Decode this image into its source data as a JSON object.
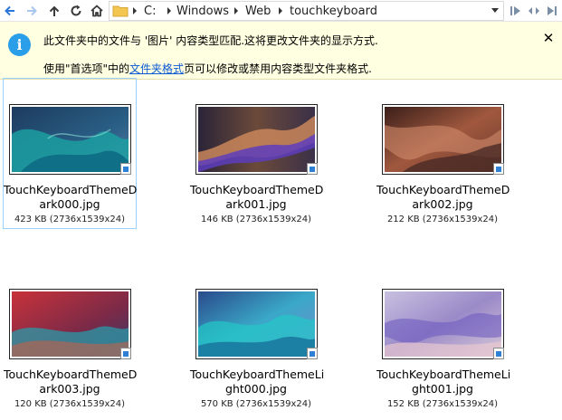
{
  "breadcrumb": {
    "items": [
      "C:",
      "Windows",
      "Web",
      "touchkeyboard"
    ]
  },
  "infobar": {
    "line1": "此文件夹中的文件与 '图片' 内容类型匹配.这将更改文件夹的显示方式.",
    "line2_prefix": "使用\"首选项\"中的",
    "line2_link": "文件夹格式",
    "line2_suffix": "页可以修改或禁用内容类型文件夹格式.",
    "close": "✕"
  },
  "files": [
    {
      "name_line1": "TouchKeyboardThemeD",
      "name_line2": "ark000.jpg",
      "info": "423 KB (2736x1539x24)"
    },
    {
      "name_line1": "TouchKeyboardThemeD",
      "name_line2": "ark001.jpg",
      "info": "146 KB (2736x1539x24)"
    },
    {
      "name_line1": "TouchKeyboardThemeD",
      "name_line2": "ark002.jpg",
      "info": "212 KB (2736x1539x24)"
    },
    {
      "name_line1": "TouchKeyboardThemeD",
      "name_line2": "ark003.jpg",
      "info": "120 KB (2736x1539x24)"
    },
    {
      "name_line1": "TouchKeyboardThemeLi",
      "name_line2": "ght000.jpg",
      "info": "570 KB (2736x1539x24)"
    },
    {
      "name_line1": "TouchKeyboardThemeLi",
      "name_line2": "ght001.jpg",
      "info": "152 KB (2736x1539x24)"
    }
  ],
  "colors": {
    "infobar_bg": "#ffffe1",
    "link": "#0b5bd3",
    "selection_border": "#99d1ff"
  },
  "icons": [
    "back-arrow-icon",
    "forward-arrow-icon",
    "up-arrow-icon",
    "refresh-icon",
    "home-icon",
    "folder-icon",
    "chevron-down-icon",
    "info-icon",
    "close-icon",
    "image-badge-icon"
  ]
}
